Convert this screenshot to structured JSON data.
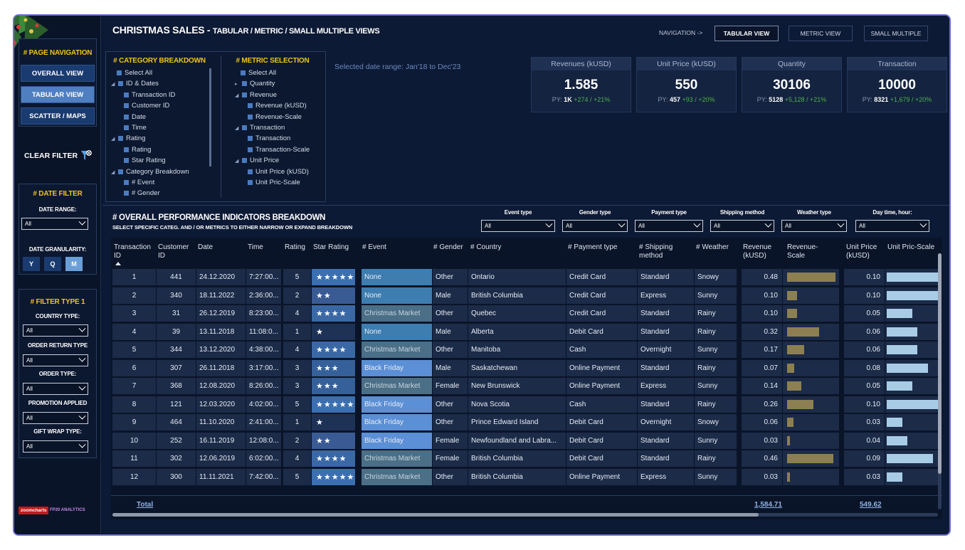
{
  "colors": {
    "accent_yellow": "#f0c419",
    "nav_active": "#4f7fc0",
    "nav_default": "#1a3b70",
    "bar_revenue": "#8c8052",
    "bar_unit_price": "#a8cce6",
    "event_none": "#3d7db0",
    "event_christmas": "#4a6f86",
    "event_black_friday": "#5b8fd6"
  },
  "sidebar": {
    "page_nav_title": "# PAGE NAVIGATION",
    "nav_buttons": [
      "OVERALL VIEW",
      "TABULAR VIEW",
      "SCATTER / MAPS"
    ],
    "clear_filter": "CLEAR FILTER",
    "clear_filter_icon": "funnel-clear-icon",
    "date_filter_title": "# DATE FILTER",
    "date_range_label": "DATE RANGE:",
    "date_range_value": "All",
    "granularity_label": "DATE GRANULARITY:",
    "granularity_options": [
      "Y",
      "Q",
      "M"
    ],
    "filter_type_title": "# FILTER TYPE 1",
    "filters": [
      {
        "label": "COUNTRY TYPE:",
        "value": "All"
      },
      {
        "label": "ORDER RETURN TYPE",
        "value": "All"
      },
      {
        "label": "ORDER TYPE:",
        "value": "All"
      },
      {
        "label": "PROMOTION APPLIED",
        "value": "All"
      },
      {
        "label": "GIFT WRAP TYPE:",
        "value": "All"
      }
    ],
    "logo1": "zoomcharts",
    "logo2": "FP20 ANALYTICS"
  },
  "header": {
    "title": "CHRISTMAS SALES -",
    "subtitle": "TABULAR / METRIC / SMALL MULTIPLE VIEWS",
    "nav_label": "NAVIGATION ->",
    "tabs": [
      "TABULAR VIEW",
      "METRIC VIEW",
      "SMALL MULTIPLE"
    ]
  },
  "category_breakdown": {
    "title": "# CATEGORY BREAKDOWN",
    "items": [
      "Select All",
      "ID & Dates",
      "Transaction ID",
      "Customer ID",
      "Date",
      "Time",
      "Rating",
      "Rating",
      "Star Rating",
      "Category Breakdown",
      "# Event",
      "# Gender"
    ]
  },
  "metric_selection": {
    "title": "# METRIC SELECTION",
    "items": [
      "Select All",
      "Quantity",
      "Revenue",
      "Revenue (kUSD)",
      "Revenue-Scale",
      "Transaction",
      "Transaction",
      "Transaction-Scale",
      "Unit Price",
      "Unit Price (kUSD)",
      "Unit Pric-Scale"
    ]
  },
  "date_range_text": "Selected date range: Jan'18 to Dec'23",
  "kpis": [
    {
      "label": "Revenues (kUSD)",
      "value": "1.585",
      "py_prefix": "PY: ",
      "py_value": "1K",
      "py_delta": " +274 / +21%"
    },
    {
      "label": "Unit Price (kUSD)",
      "value": "550",
      "py_prefix": "PY: ",
      "py_value": "457",
      "py_delta": " +93 / +20%"
    },
    {
      "label": "Quantity",
      "value": "30106",
      "py_prefix": "PY: ",
      "py_value": "5128",
      "py_delta": " +5,128 / +21%"
    },
    {
      "label": "Transaction",
      "value": "10000",
      "py_prefix": "PY: ",
      "py_value": "8321",
      "py_delta": " +1,679 / +20%"
    }
  ],
  "breakdown": {
    "title": "# OVERALL PERFORMANCE INDICATORS BREAKDOWN",
    "subtitle": "SELECT SPECIFIC CATEG. AND / OR METRICS TO EITHER NARROW OR EXPAND  BREAKDOWN",
    "filters": [
      {
        "label": "Event type",
        "value": "All"
      },
      {
        "label": "Gender type",
        "value": "All"
      },
      {
        "label": "Payment type",
        "value": "All"
      },
      {
        "label": "Shipping method",
        "value": "All"
      },
      {
        "label": "Weather type",
        "value": "All"
      },
      {
        "label": "Day time, hour:",
        "value": "All"
      }
    ]
  },
  "table": {
    "headers": [
      "Transaction ID",
      "Customer ID",
      "Date",
      "Time",
      "Rating",
      "Star Rating",
      "# Event",
      "# Gender",
      "# Country",
      "# Payment type",
      "# Shipping method",
      "# Weather",
      "Revenue (kUSD)",
      "Revenue-Scale",
      "Unit Price (kUSD)",
      "Unit Pric-Scale"
    ],
    "rows": [
      {
        "id": "1",
        "cust": "441",
        "date": "24.12.2020",
        "time": "7:27:00...",
        "rating": "5",
        "stars": "★★★★★",
        "event": "None",
        "gender": "Other",
        "country": "Ontario",
        "payment": "Credit Card",
        "shipping": "Standard",
        "weather": "Snowy",
        "revenue": "0.48",
        "rev_num": 0.48,
        "unit": "0.10",
        "unit_num": 0.1
      },
      {
        "id": "2",
        "cust": "340",
        "date": "18.11.2022",
        "time": "2:36:00...",
        "rating": "2",
        "stars": "★★",
        "event": "None",
        "gender": "Male",
        "country": "British Columbia",
        "payment": "Credit Card",
        "shipping": "Express",
        "weather": "Sunny",
        "revenue": "0.10",
        "rev_num": 0.1,
        "unit": "0.10",
        "unit_num": 0.1
      },
      {
        "id": "3",
        "cust": "31",
        "date": "26.12.2019",
        "time": "8:23:00...",
        "rating": "4",
        "stars": "★★★★",
        "event": "Christmas Market",
        "gender": "Other",
        "country": "Quebec",
        "payment": "Credit Card",
        "shipping": "Standard",
        "weather": "Rainy",
        "revenue": "0.10",
        "rev_num": 0.1,
        "unit": "0.05",
        "unit_num": 0.05
      },
      {
        "id": "4",
        "cust": "39",
        "date": "13.11.2018",
        "time": "11:08:0...",
        "rating": "1",
        "stars": "★",
        "event": "None",
        "gender": "Male",
        "country": "Alberta",
        "payment": "Debit Card",
        "shipping": "Standard",
        "weather": "Rainy",
        "revenue": "0.32",
        "rev_num": 0.32,
        "unit": "0.06",
        "unit_num": 0.06
      },
      {
        "id": "5",
        "cust": "344",
        "date": "13.12.2020",
        "time": "4:38:00...",
        "rating": "4",
        "stars": "★★★★",
        "event": "Christmas Market",
        "gender": "Other",
        "country": "Manitoba",
        "payment": "Cash",
        "shipping": "Overnight",
        "weather": "Sunny",
        "revenue": "0.17",
        "rev_num": 0.17,
        "unit": "0.06",
        "unit_num": 0.06
      },
      {
        "id": "6",
        "cust": "307",
        "date": "26.11.2018",
        "time": "3:17:00...",
        "rating": "3",
        "stars": "★★★",
        "event": "Black Friday",
        "gender": "Male",
        "country": "Saskatchewan",
        "payment": "Online Payment",
        "shipping": "Standard",
        "weather": "Rainy",
        "revenue": "0.07",
        "rev_num": 0.07,
        "unit": "0.08",
        "unit_num": 0.08
      },
      {
        "id": "7",
        "cust": "368",
        "date": "12.08.2020",
        "time": "8:26:00...",
        "rating": "3",
        "stars": "★★★",
        "event": "Christmas Market",
        "gender": "Female",
        "country": "New Brunswick",
        "payment": "Online Payment",
        "shipping": "Express",
        "weather": "Sunny",
        "revenue": "0.14",
        "rev_num": 0.14,
        "unit": "0.05",
        "unit_num": 0.05
      },
      {
        "id": "8",
        "cust": "121",
        "date": "12.03.2020",
        "time": "4:02:00...",
        "rating": "5",
        "stars": "★★★★★",
        "event": "Black Friday",
        "gender": "Other",
        "country": "Nova Scotia",
        "payment": "Cash",
        "shipping": "Standard",
        "weather": "Rainy",
        "revenue": "0.26",
        "rev_num": 0.26,
        "unit": "0.10",
        "unit_num": 0.1
      },
      {
        "id": "9",
        "cust": "464",
        "date": "11.10.2020",
        "time": "2:41:00...",
        "rating": "1",
        "stars": "★",
        "event": "Black Friday",
        "gender": "Other",
        "country": "Prince Edward Island",
        "payment": "Debit Card",
        "shipping": "Overnight",
        "weather": "Snowy",
        "revenue": "0.06",
        "rev_num": 0.06,
        "unit": "0.03",
        "unit_num": 0.03
      },
      {
        "id": "10",
        "cust": "252",
        "date": "16.11.2019",
        "time": "12:08:0...",
        "rating": "2",
        "stars": "★★",
        "event": "Black Friday",
        "gender": "Female",
        "country": "Newfoundland and Labra...",
        "payment": "Debit Card",
        "shipping": "Standard",
        "weather": "Sunny",
        "revenue": "0.03",
        "rev_num": 0.03,
        "unit": "0.04",
        "unit_num": 0.04
      },
      {
        "id": "11",
        "cust": "302",
        "date": "12.06.2019",
        "time": "6:02:00...",
        "rating": "4",
        "stars": "★★★★",
        "event": "Christmas Market",
        "gender": "Female",
        "country": "British Columbia",
        "payment": "Debit Card",
        "shipping": "Standard",
        "weather": "Rainy",
        "revenue": "0.46",
        "rev_num": 0.46,
        "unit": "0.09",
        "unit_num": 0.09
      },
      {
        "id": "12",
        "cust": "300",
        "date": "11.11.2021",
        "time": "7:42:00...",
        "rating": "5",
        "stars": "★★★★★",
        "event": "Christmas Market",
        "gender": "Other",
        "country": "British Columbia",
        "payment": "Online Payment",
        "shipping": "Express",
        "weather": "Sunny",
        "revenue": "0.03",
        "rev_num": 0.03,
        "unit": "0.03",
        "unit_num": 0.03
      }
    ],
    "total_label": "Total",
    "total_revenue": "1,584.71",
    "total_unit": "549.62"
  }
}
